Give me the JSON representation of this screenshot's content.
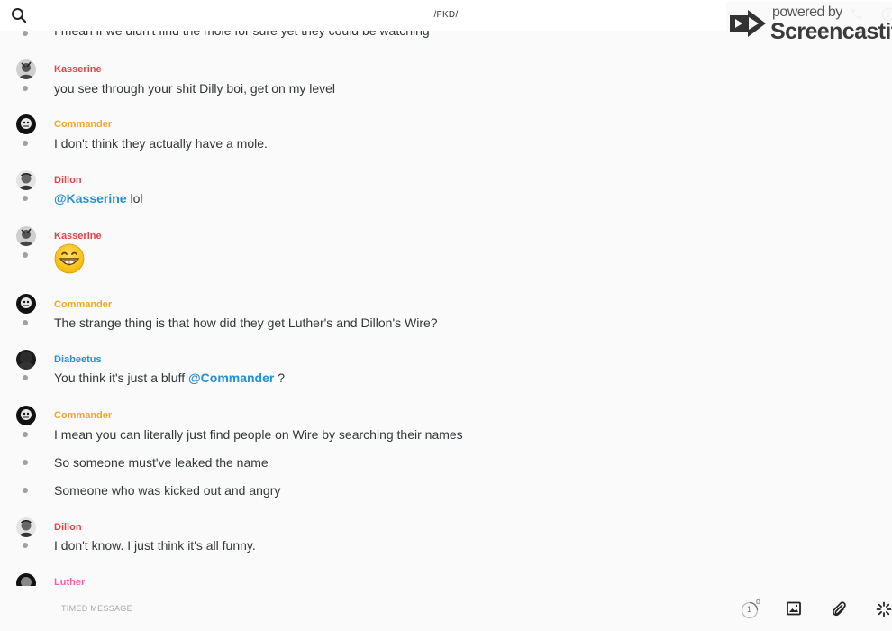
{
  "header": {
    "title": "/FKD/"
  },
  "watermark": {
    "powered_by": "powered by",
    "brand": "Screencastify"
  },
  "colors": {
    "kasserine": "#e2444a",
    "commander": "#f5a623",
    "dillon": "#e2444a",
    "diabeetus": "#2391d3",
    "luther": "#fe5ba8",
    "mention": "#2391d3"
  },
  "messages": [
    {
      "text": "I mean if we didn't find the mole for sure yet they could be watching"
    },
    {
      "user": "Kasserine",
      "text": "you see through your shit Dilly boi, get on my level"
    },
    {
      "user": "Commander",
      "text": "I don't think they actually have a mole."
    },
    {
      "user": "Dillon",
      "mention": "@Kasserine",
      "text": " lol"
    },
    {
      "user": "Kasserine",
      "emoji": "grinning-face-emoji"
    },
    {
      "user": "Commander",
      "text": "The strange thing is that how did they get Luther's and Dillon's Wire?"
    },
    {
      "user": "Diabeetus",
      "text_before": "You think it's just a bluff ",
      "mention": "@Commander",
      "text_after": " ?"
    },
    {
      "user": "Commander",
      "text": "I mean you can literally just find people on Wire by searching their names"
    },
    {
      "text": "So someone must've leaked the name"
    },
    {
      "text": "Someone who was kicked out and angry"
    },
    {
      "user": "Dillon",
      "text": "I don't know. I just think it's all funny."
    },
    {
      "user": "Luther"
    }
  ],
  "footer": {
    "placeholder": "TIMED MESSAGE",
    "timer_value": "1",
    "timer_unit": "d"
  }
}
